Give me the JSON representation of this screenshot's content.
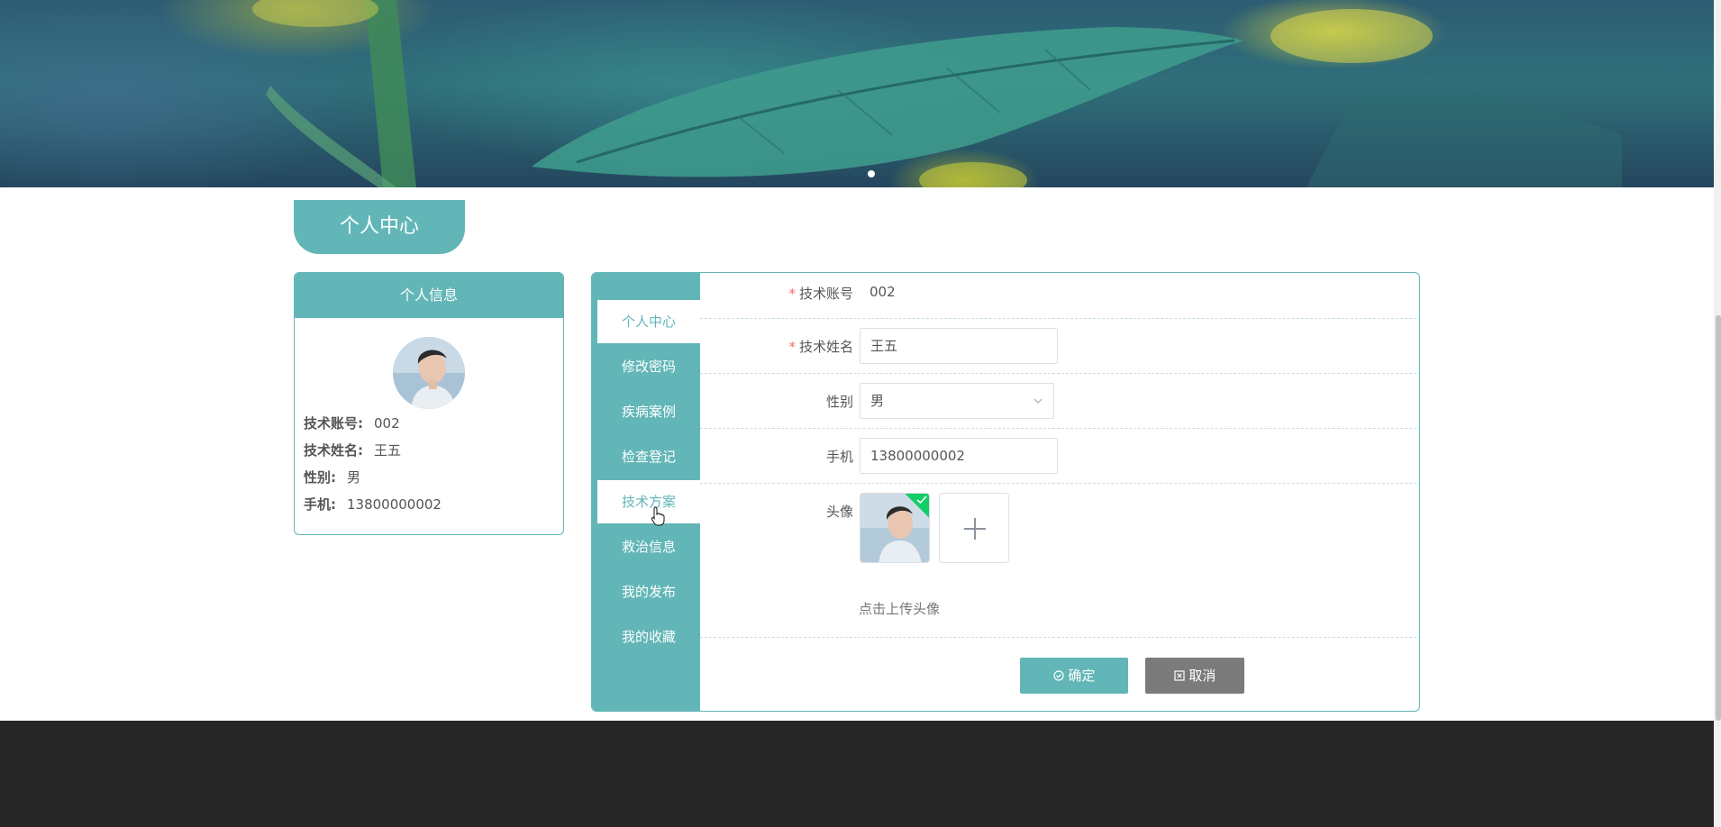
{
  "page_title": "个人中心",
  "info_card": {
    "header": "个人信息",
    "rows": [
      {
        "label": "技术账号:",
        "value": "002"
      },
      {
        "label": "技术姓名:",
        "value": "王五"
      },
      {
        "label": "性别:",
        "value": "男"
      },
      {
        "label": "手机:",
        "value": "13800000002"
      }
    ]
  },
  "side_nav": {
    "items": [
      {
        "label": "个人中心",
        "active": true
      },
      {
        "label": "修改密码",
        "active": false
      },
      {
        "label": "疾病案例",
        "active": false
      },
      {
        "label": "检查登记",
        "active": false
      },
      {
        "label": "技术方案",
        "active": false,
        "hovered": true
      },
      {
        "label": "救治信息",
        "active": false
      },
      {
        "label": "我的发布",
        "active": false
      },
      {
        "label": "我的收藏",
        "active": false
      }
    ]
  },
  "form": {
    "required_mark": "*",
    "account_label": "技术账号",
    "account_value": "002",
    "name_label": "技术姓名",
    "name_value": "王五",
    "gender_label": "性别",
    "gender_value": "男",
    "phone_label": "手机",
    "phone_value": "13800000002",
    "avatar_label": "头像",
    "upload_hint": "点击上传头像",
    "confirm_label": "确定",
    "cancel_label": "取消"
  },
  "colors": {
    "accent": "#62b6b7",
    "footer": "#262626",
    "cancel": "#7b7b7b",
    "required": "#f56c6c",
    "success": "#13ce66"
  },
  "icons": {
    "confirm": "check-circle-icon",
    "cancel": "close-square-icon",
    "select": "chevron-down-icon",
    "upload": "plus-icon",
    "uploaded": "check-icon"
  },
  "carousel": {
    "slides": 1,
    "active": 1
  }
}
